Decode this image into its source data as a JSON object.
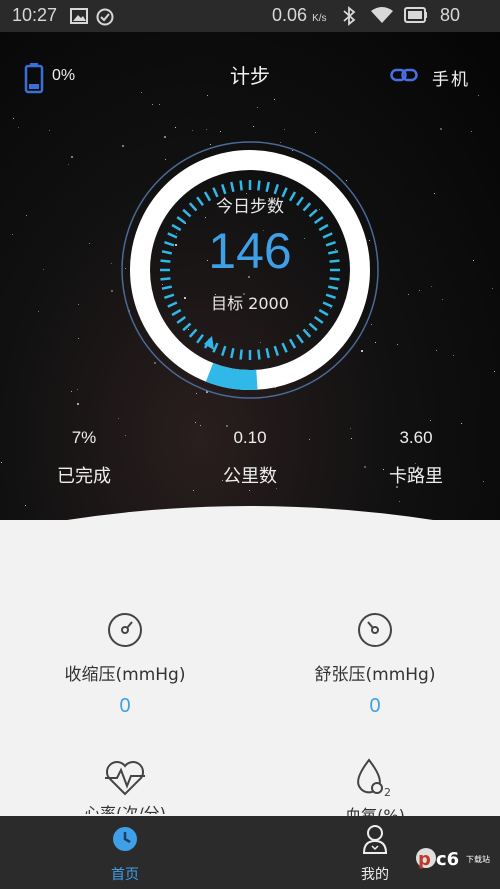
{
  "status_bar": {
    "time": "10:27",
    "speed": "0.06",
    "speed_unit": "K/s",
    "battery": "80"
  },
  "header": {
    "battery_pct": "0%",
    "title": "计步",
    "device_label": "手机"
  },
  "pedometer": {
    "today_label": "今日步数",
    "steps": "146",
    "goal_label": "目标 2000",
    "progress": 0.07
  },
  "stats": [
    {
      "value": "7%",
      "label": "已完成"
    },
    {
      "value": "0.10",
      "label": "公里数"
    },
    {
      "value": "3.60",
      "label": "卡路里"
    }
  ],
  "blood_pressure": {
    "systolic_label": "收缩压(mmHg)",
    "systolic_value": "0",
    "diastolic_label": "舒张压(mmHg)",
    "diastolic_value": "0"
  },
  "more_metrics": {
    "heart_label": "心率(次/分)",
    "oxygen_label": "血氧(%)"
  },
  "nav": {
    "home": "首页",
    "mine": "我的"
  },
  "colors": {
    "accent": "#3fa0e8",
    "progress": "#2fb8e8",
    "nav_bg": "#2b2b2b",
    "panel_bg": "#f2f2f2"
  },
  "icons": [
    "gallery-icon",
    "check-circle-icon",
    "bluetooth-icon",
    "wifi-icon",
    "battery-icon",
    "link-icon",
    "gauge-icon",
    "heart-pulse-icon",
    "drop-o2-icon",
    "clock-icon",
    "person-icon"
  ]
}
